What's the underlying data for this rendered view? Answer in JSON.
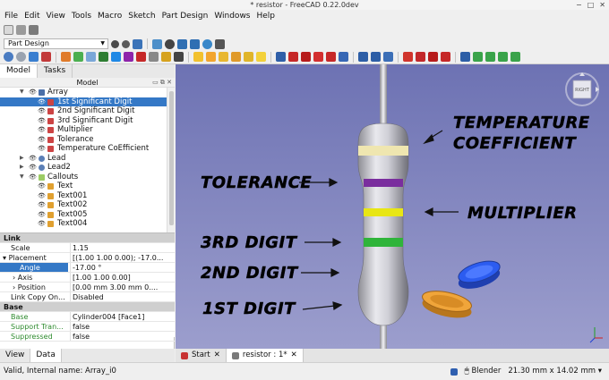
{
  "window": {
    "title": "* resistor - FreeCAD 0.22.0dev",
    "controls": [
      "−",
      "□",
      "✕"
    ]
  },
  "menu": [
    "File",
    "Edit",
    "View",
    "Tools",
    "Macro",
    "Sketch",
    "Part Design",
    "Windows",
    "Help"
  ],
  "workbench": {
    "selected": "Part Design"
  },
  "panel": {
    "tabs": [
      "Model",
      "Tasks"
    ],
    "header": "Model",
    "header_icons": "▭ ⧉ ✕"
  },
  "tree": [
    {
      "label": "Array",
      "expanded": true
    },
    {
      "label": "1st Significant Digit",
      "selected": true
    },
    {
      "label": "2nd Significant Digit"
    },
    {
      "label": "3rd Significant Digit"
    },
    {
      "label": "Multiplier"
    },
    {
      "label": "Tolerance"
    },
    {
      "label": "Temperature CoEfficient"
    },
    {
      "label": "Lead",
      "expanded": false
    },
    {
      "label": "Lead2",
      "expanded": false
    },
    {
      "label": "Callouts",
      "expanded": true
    },
    {
      "label": "Text"
    },
    {
      "label": "Text001"
    },
    {
      "label": "Text002"
    },
    {
      "label": "Text005"
    },
    {
      "label": "Text004"
    }
  ],
  "properties": [
    {
      "group": "Link"
    },
    {
      "name": "Scale",
      "value": "1.15"
    },
    {
      "name": "Placement",
      "value": "[(1.00 1.00 0.00); -17.0...",
      "arrow": "▾"
    },
    {
      "name": "Angle",
      "value": "-17.00 °",
      "selected": true
    },
    {
      "name": "Axis",
      "value": "[1.00 1.00 0.00]",
      "arrow": "›"
    },
    {
      "name": "Position",
      "value": "[0.00 mm  3.00 mm  0....",
      "arrow": "›"
    },
    {
      "name": "Link Copy On...",
      "value": "Disabled"
    },
    {
      "group": "Base"
    },
    {
      "name": "Base",
      "value": "Cylinder004 [Face1]",
      "green": true
    },
    {
      "name": "Support Tran...",
      "value": "false",
      "green": true
    },
    {
      "name": "Suppressed",
      "value": "false",
      "green": true
    }
  ],
  "bottom_tabs": [
    "View",
    "Data"
  ],
  "doc_tabs": [
    {
      "label": "Start",
      "close": "✕"
    },
    {
      "label": "resistor : 1*",
      "close": "✕",
      "active": true
    }
  ],
  "view3d": {
    "navcube_face": "RIGHT",
    "callouts": {
      "temperature_line1": "TEMPERATURE",
      "temperature_line2": "COEFFICIENT",
      "tolerance": "TOLERANCE",
      "multiplier": "MULTIPLIER",
      "digit3": "3RD DIGIT",
      "digit2": "2ND DIGIT",
      "digit1": "1ST DIGIT"
    },
    "band_colors": {
      "temperature": "#efe6b0",
      "tolerance": "#7a2e9e",
      "multiplier": "#e8e615",
      "digit3": "#2fb43a"
    }
  },
  "status": {
    "message": "Valid, Internal name: Array_i0",
    "navigation": "Blender",
    "dimensions": "21.30 mm x 14.02 mm"
  },
  "colors": {
    "selection": "#3478c6",
    "view_top": "#6d72b3",
    "view_bottom": "#9c9ecd"
  }
}
